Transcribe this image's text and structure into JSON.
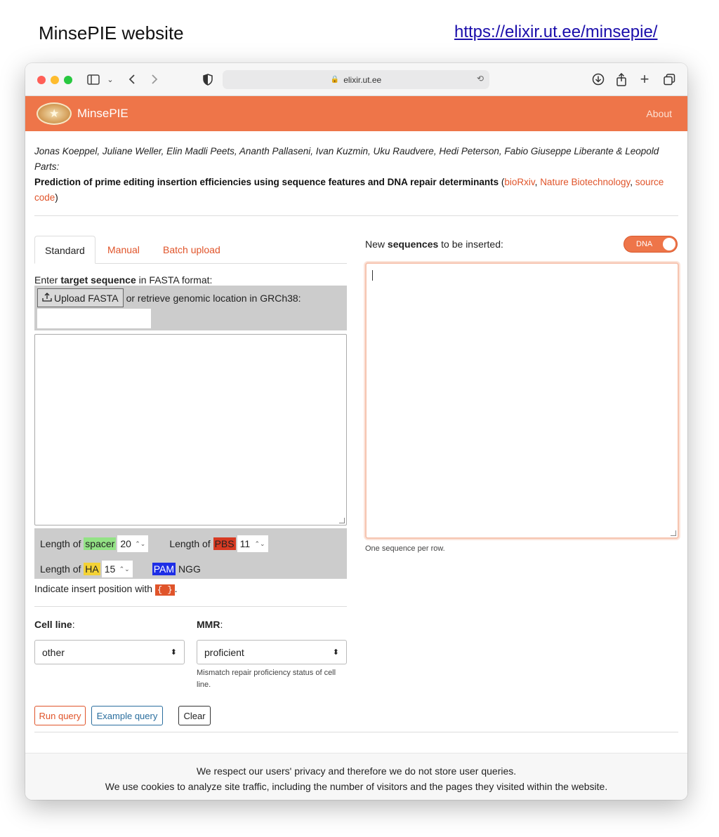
{
  "heading": "MinsePIE website",
  "heading_link": "https://elixir.ut.ee/minsepie/",
  "browser": {
    "address": "elixir.ut.ee"
  },
  "navbar": {
    "brand": "MinsePIE",
    "about": "About"
  },
  "citation": {
    "authors": "Jonas Koeppel, Juliane Weller, Elin Madli Peets, Ananth Pallaseni, Ivan Kuzmin, Uku Raudvere, Hedi Peterson, Fabio Giuseppe Liberante & Leopold Parts:",
    "title": "Prediction of prime editing insertion efficiencies using sequence features and DNA repair determinants",
    "open_paren": " (",
    "link1": "bioRxiv",
    "sep1": ", ",
    "link2": "Nature Biotechnology",
    "sep2": ", ",
    "link3": "source code",
    "close_paren": ")"
  },
  "tabs": {
    "standard": "Standard",
    "manual": "Manual",
    "batch": "Batch upload"
  },
  "target": {
    "label_pre": "Enter ",
    "label_bold": "target sequence",
    "label_post": " in FASTA format:",
    "upload_button": "Upload FASTA",
    "retrieve_text": "or retrieve genomic location in GRCh38:"
  },
  "params": {
    "length_of": "Length of",
    "spacer_label": "spacer",
    "spacer_value": "20",
    "pbs_label": "PBS",
    "pbs_value": "11",
    "ha_label": "HA",
    "ha_value": "15",
    "pam_label": "PAM",
    "pam_value": "NGG"
  },
  "insert_hint": {
    "text": "Indicate insert position with",
    "code": "{ }",
    "end": "."
  },
  "cell_line": {
    "label": "Cell line",
    "colon": ":",
    "value": "other"
  },
  "mmr": {
    "label": "MMR",
    "colon": ":",
    "value": "proficient",
    "help": "Mismatch repair proficiency status of cell line."
  },
  "buttons": {
    "run": "Run query",
    "example": "Example query",
    "clear": "Clear"
  },
  "sequences": {
    "label_pre": "New ",
    "label_bold": "sequences",
    "label_post": " to be inserted:",
    "toggle": "DNA",
    "help": "One sequence per row."
  },
  "footer": {
    "line1": "We respect our users' privacy and therefore we do not store user queries.",
    "line2": "We use cookies to analyze site traffic, including the number of visitors and the pages they visited within the website."
  },
  "colors": {
    "accent": "#ee7549",
    "link": "#e0542a",
    "spacer": "#93e285",
    "pbs": "#d73a22",
    "ha": "#f3d235",
    "pam": "#1e2ee6"
  }
}
